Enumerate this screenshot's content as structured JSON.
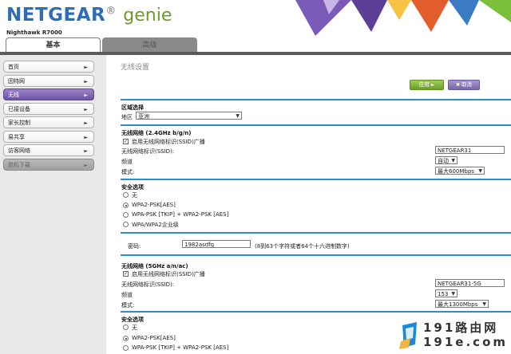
{
  "header": {
    "brand_name": "NETGEAR",
    "brand_dot": "®",
    "brand_product": "genie",
    "model": "Nighthawk R7000",
    "deco_colors": [
      "#6c4aa4",
      "#f5c242",
      "#e35d2c",
      "#3b7bc4",
      "#7cbf3a"
    ]
  },
  "tabs": [
    {
      "label": "基本",
      "active": true
    },
    {
      "label": "高级",
      "active": false
    }
  ],
  "sidebar": {
    "items": [
      {
        "label": "首页"
      },
      {
        "label": "因特网"
      },
      {
        "label": "无线",
        "active": true
      },
      {
        "label": "已接设备"
      },
      {
        "label": "家长控制"
      },
      {
        "label": "易共享"
      },
      {
        "label": "访客网络"
      },
      {
        "label": "脱机下载",
        "disabled": true
      }
    ],
    "arrow": "►"
  },
  "main": {
    "title": "无线设置",
    "apply_label": "应用",
    "apply_icon": "►",
    "cancel_label": "取消",
    "cancel_icon": "✖",
    "region": {
      "section_title": "区域选择",
      "label": "地区",
      "value": "亚洲"
    },
    "net24": {
      "section_title": "无线网络 (2.4GHz b/g/n)",
      "broadcast_label": "启用无线网络标识(SSID)广播",
      "broadcast_checked": true,
      "ssid_label": "无线网络标识(SSID):",
      "ssid_value": "NETGEAR31",
      "channel_label": "频道",
      "channel_value": "自动",
      "mode_label": "模式:",
      "mode_value": "最大600Mbps"
    },
    "security24": {
      "section_title": "安全选项",
      "options": [
        "无",
        "WPA2-PSK[AES]",
        "WPA-PSK [TKIP] + WPA2-PSK [AES]",
        "WPA/WPA2企业级"
      ],
      "selected": 1,
      "passphrase_label": "密码:",
      "passphrase_value": "1982asdfg",
      "passphrase_hint": "(8到63个字符或者64个十六进制数字)"
    },
    "net5": {
      "section_title": "无线网络 (5GHz a/n/ac)",
      "broadcast_label": "启用无线网络标识(SSID)广播",
      "broadcast_checked": true,
      "ssid_label": "无线网络标识(SSID):",
      "ssid_value": "NETGEAR31-5G",
      "channel_label": "频道",
      "channel_value": "153",
      "mode_label": "模式:",
      "mode_value": "最大1300Mbps"
    },
    "security5": {
      "section_title": "安全选项",
      "options": [
        "无",
        "WPA2-PSK[AES]",
        "WPA-PSK [TKIP] + WPA2-PSK [AES]"
      ],
      "selected": 1
    },
    "select_chevron": "▼"
  },
  "watermark": {
    "line1": "191路由网",
    "line2": "191e.com"
  }
}
